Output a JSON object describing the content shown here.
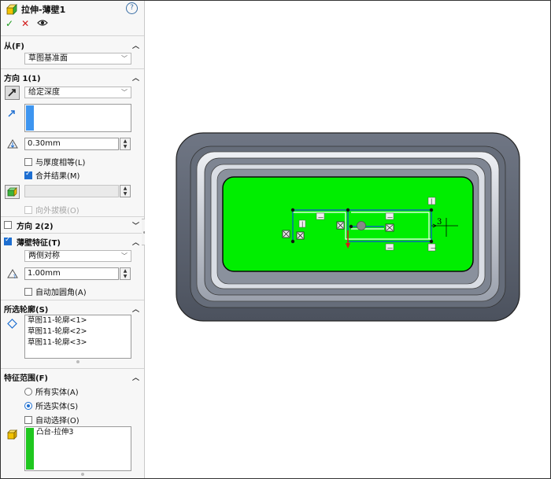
{
  "title": "拉伸-薄壁1",
  "help_icon": "?",
  "actions": {
    "ok": "✓",
    "cancel": "✕",
    "preview": "eye-icon"
  },
  "from": {
    "header": "从(F)",
    "dropdown": "草图基准面"
  },
  "direction1": {
    "header": "方向 1(1)",
    "end_condition": "给定深度",
    "depth": "0.30mm",
    "equal_thickness": "与厚度相等(L)",
    "merge_result": "合并结果(M)",
    "draft_outward": "向外拔模(O)"
  },
  "direction2": {
    "header": "方向 2(2)"
  },
  "thin_feature": {
    "header": "薄壁特征(T)",
    "type": "两侧对称",
    "thickness": "1.00mm",
    "auto_fillet": "自动加圆角(A)"
  },
  "selected_contours": {
    "header": "所选轮廓(S)",
    "items": [
      "草图11-轮廓<1>",
      "草图11-轮廓<2>",
      "草图11-轮廓<3>"
    ]
  },
  "feature_scope": {
    "header": "特征范围(F)",
    "all_bodies": "所有实体(A)",
    "selected_bodies": "所选实体(S)",
    "auto_select": "自动选择(O)",
    "body": "凸台-拉伸3"
  },
  "sketch": {
    "dim_label": "3",
    "relation_marks": [
      "—",
      "—",
      "|",
      "|",
      "—",
      "—"
    ]
  },
  "colors": {
    "accent": "#1e6fd1",
    "sketch_face": "#00ee00",
    "plate": "#5f6674"
  }
}
